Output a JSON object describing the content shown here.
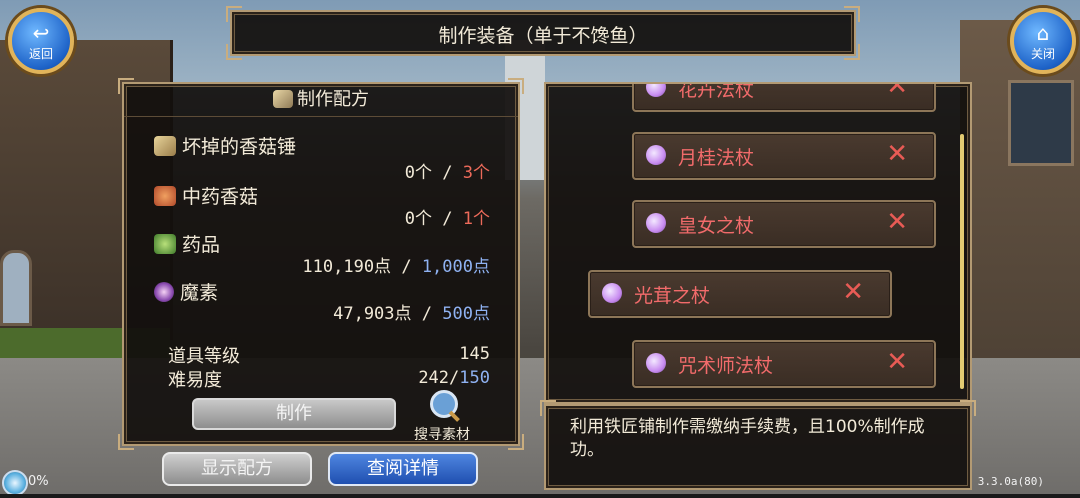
{
  "header": {
    "title": "制作装备（单于不馋鱼）"
  },
  "nav": {
    "back_label": "返回",
    "back_glyph": "↩",
    "close_label": "关闭",
    "close_glyph": "⌂"
  },
  "recipe": {
    "title": "制作配方",
    "materials": [
      {
        "name": "坏掉的香菇锤",
        "have": "0个",
        "need": "3个",
        "icon": "hammer-icon"
      },
      {
        "name": "中药香菇",
        "have": "0个",
        "need": "1个",
        "icon": "mushroom-icon"
      },
      {
        "name": "药品",
        "have": "110,190点",
        "need": "1,000点",
        "icon": "herb-icon"
      },
      {
        "name": "魔素",
        "have": "47,903点",
        "need": "500点",
        "icon": "magic-orb-icon"
      }
    ],
    "separator": "/",
    "item_level_label": "道具等级",
    "item_level_value": "145",
    "difficulty_label": "难易度",
    "difficulty_have": "242",
    "difficulty_need": "150",
    "make_button": "制作",
    "search_label": "搜寻素材"
  },
  "bottom_buttons": {
    "show_recipe": "显示配方",
    "view_details": "查阅详情"
  },
  "equipment_list": [
    {
      "name": "花卉法杖",
      "remove": "✕"
    },
    {
      "name": "月桂法杖",
      "remove": "✕"
    },
    {
      "name": "皇女之杖",
      "remove": "✕"
    },
    {
      "name": "光茸之杖",
      "remove": "✕"
    },
    {
      "name": "咒术师法杖",
      "remove": "✕"
    }
  ],
  "description": "利用铁匠铺制作需缴纳手续费，且100%制作成功。",
  "status": {
    "exp_percent": "0%",
    "version": "3.3.0a(80)"
  },
  "colors": {
    "accent_red": "#ec6a5a",
    "accent_blue": "#8fb2f2",
    "frame_gold": "#b39a73"
  }
}
